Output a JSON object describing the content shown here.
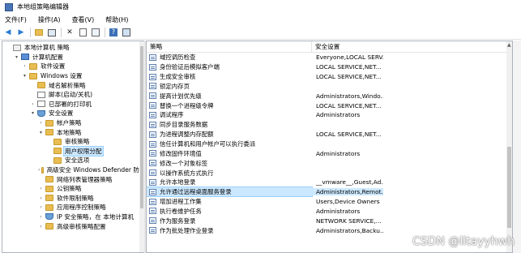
{
  "window": {
    "title": "本地组策略编辑器"
  },
  "menu": [
    "文件(F)",
    "操作(A)",
    "查看(V)",
    "帮助(H)"
  ],
  "toolbar": {
    "icons": [
      "back-arrow-icon",
      "forward-arrow-icon",
      "up-folder-icon",
      "show-hide-tree-icon",
      "delete-icon",
      "properties-icon",
      "export-list-icon",
      "help-icon",
      "console-icon"
    ]
  },
  "tree": [
    {
      "label": "本地计算机 策略",
      "level": 0,
      "icon": "policy",
      "twisty": ""
    },
    {
      "label": "计算机配置",
      "level": 1,
      "icon": "computer",
      "twisty": "▾"
    },
    {
      "label": "软件设置",
      "level": 2,
      "icon": "folder",
      "twisty": "›"
    },
    {
      "label": "Windows 设置",
      "level": 2,
      "icon": "folder",
      "twisty": "▾"
    },
    {
      "label": "域名解析策略",
      "level": 3,
      "icon": "folder",
      "twisty": ""
    },
    {
      "label": "脚本(启动/关机)",
      "level": 3,
      "icon": "doc",
      "twisty": ""
    },
    {
      "label": "已部署的打印机",
      "level": 3,
      "icon": "doc",
      "twisty": "›"
    },
    {
      "label": "安全设置",
      "level": 3,
      "icon": "shield",
      "twisty": "▾"
    },
    {
      "label": "帐户策略",
      "level": 4,
      "icon": "folder",
      "twisty": "›"
    },
    {
      "label": "本地策略",
      "level": 4,
      "icon": "folder",
      "twisty": "▾"
    },
    {
      "label": "审核策略",
      "level": 5,
      "icon": "folder",
      "twisty": ""
    },
    {
      "label": "用户权限分配",
      "level": 5,
      "icon": "folder",
      "twisty": "",
      "selected": true
    },
    {
      "label": "安全选项",
      "level": 5,
      "icon": "folder",
      "twisty": ""
    },
    {
      "label": "高级安全 Windows Defender 防",
      "level": 4,
      "icon": "folder",
      "twisty": "›"
    },
    {
      "label": "网络列表管理器策略",
      "level": 4,
      "icon": "folder",
      "twisty": ""
    },
    {
      "label": "公钥策略",
      "level": 4,
      "icon": "folder",
      "twisty": "›"
    },
    {
      "label": "软件限制策略",
      "level": 4,
      "icon": "folder",
      "twisty": "›"
    },
    {
      "label": "应用程序控制策略",
      "level": 4,
      "icon": "folder",
      "twisty": "›"
    },
    {
      "label": "IP 安全策略，在 本地计算机",
      "level": 4,
      "icon": "shield",
      "twisty": "›"
    },
    {
      "label": "高级审核策略配置",
      "level": 4,
      "icon": "folder",
      "twisty": "›"
    }
  ],
  "table": {
    "headers": [
      "策略",
      "安全设置"
    ],
    "rows": [
      {
        "policy": "域控调历检查",
        "setting": "Everyone,LOCAL SERV..."
      },
      {
        "policy": "身份验证后模拟客户端",
        "setting": "LOCAL SERVICE,NET..."
      },
      {
        "policy": "生成安全审核",
        "setting": "LOCAL SERVICE,NET..."
      },
      {
        "policy": "锁定内存页",
        "setting": ""
      },
      {
        "policy": "提高计划优先级",
        "setting": "Administrators,Windo..."
      },
      {
        "policy": "替换一个进程级令牌",
        "setting": "LOCAL SERVICE,NET..."
      },
      {
        "policy": "调试程序",
        "setting": "Administrators"
      },
      {
        "policy": "同步目录服务数据",
        "setting": ""
      },
      {
        "policy": "为进程调整内存配额",
        "setting": "LOCAL SERVICE,NET..."
      },
      {
        "policy": "信任计算机和用户帐户可以执行委派",
        "setting": ""
      },
      {
        "policy": "修改固件环境值",
        "setting": "Administrators"
      },
      {
        "policy": "修改一个对象标签",
        "setting": ""
      },
      {
        "policy": "以操作系统方式执行",
        "setting": ""
      },
      {
        "policy": "允许本地登录",
        "setting": "__vmware__,Guest,Ad..."
      },
      {
        "policy": "允许通过远程桌面服务登录",
        "setting": "Administrators,Remot...",
        "selected": true
      },
      {
        "policy": "增加进程工作集",
        "setting": "Users,Device Owners"
      },
      {
        "policy": "执行卷维护任务",
        "setting": "Administrators"
      },
      {
        "policy": "作为服务登录",
        "setting": "NETWORK SERVICE,..."
      },
      {
        "policy": "作为批处理作业登录",
        "setting": "Administrators,Backu..."
      }
    ]
  },
  "watermark": "CSDN @litayyhwh"
}
